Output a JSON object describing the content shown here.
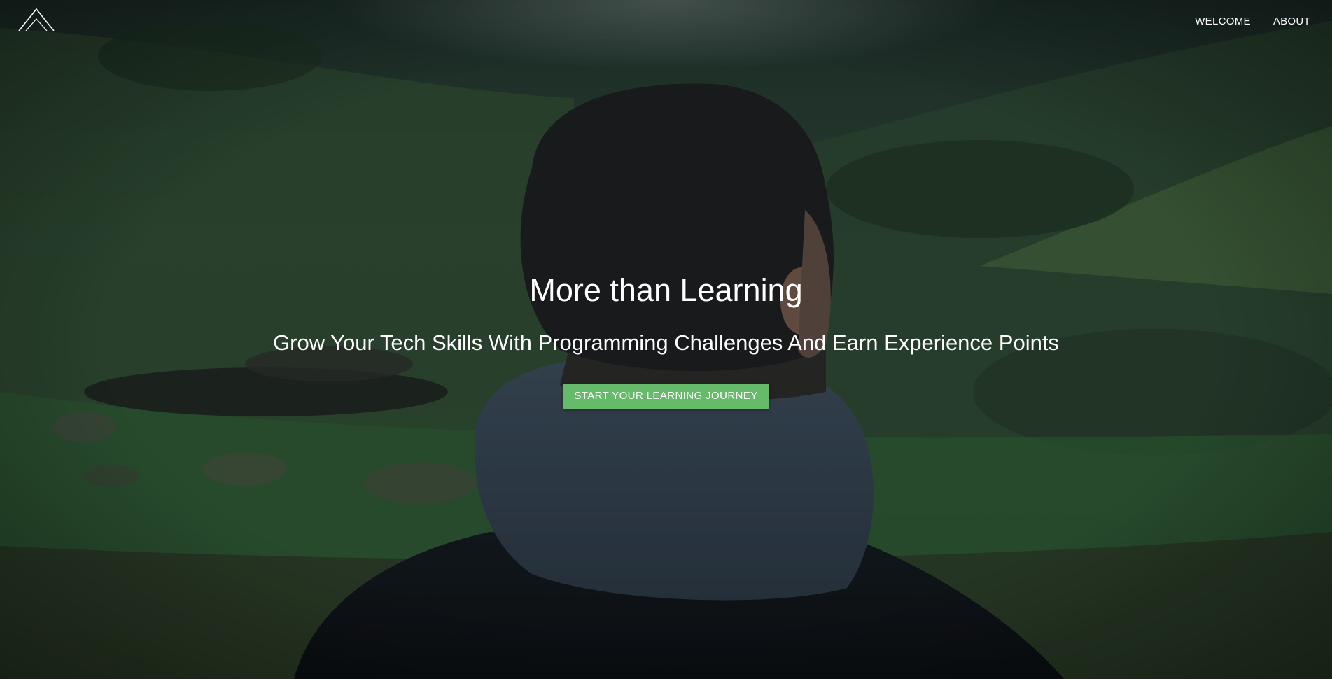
{
  "brand": {
    "logo_icon": "mountain-logo-icon"
  },
  "nav": {
    "items": [
      {
        "label": "WELCOME"
      },
      {
        "label": "ABOUT"
      }
    ]
  },
  "hero": {
    "title": "More than Learning",
    "subtitle": "Grow Your Tech Skills With Programming Challenges And Earn Experience Points",
    "cta_label": "START YOUR LEARNING JOURNEY",
    "background_image": "person-in-hoodie-facing-green-valley"
  },
  "colors": {
    "accent": "#66bb6a",
    "text": "#ffffff",
    "background": "#1e2a24"
  }
}
